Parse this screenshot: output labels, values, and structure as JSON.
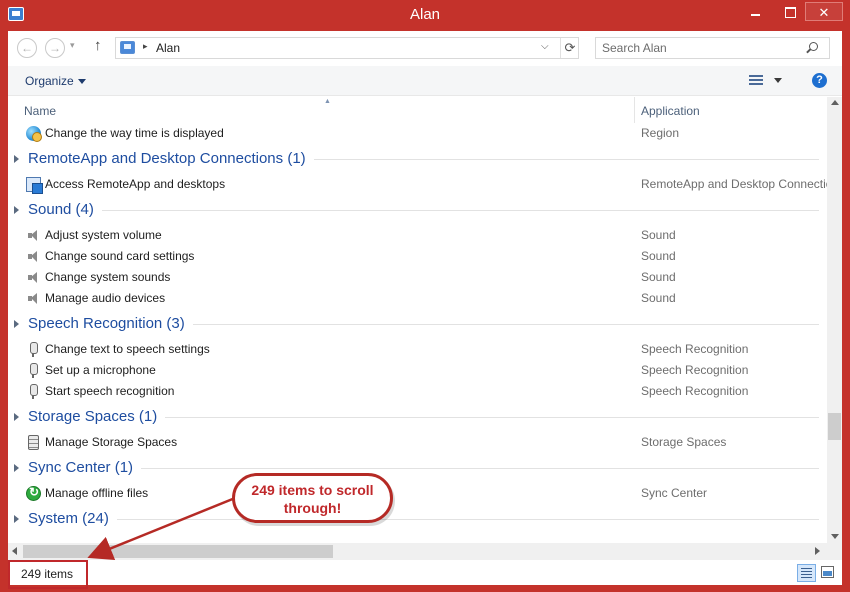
{
  "window": {
    "title": "Alan",
    "minimize_icon": "minimize-icon",
    "maximize_icon": "maximize-icon",
    "close_icon": "close-icon",
    "close_glyph": "✕"
  },
  "nav": {
    "back_glyph": "←",
    "forward_glyph": "→",
    "history_glyph": "▾",
    "up_glyph": "↑",
    "address_text": "Alan",
    "address_sep": "▸",
    "address_drop": "⌵",
    "refresh_glyph": "⟳",
    "search_placeholder": "Search Alan"
  },
  "command_bar": {
    "organize_label": "Organize"
  },
  "columns": {
    "name": "Name",
    "application": "Application",
    "sort_glyph": "▲"
  },
  "list": [
    {
      "kind": "item",
      "icon": "globe-clock-icon",
      "name": "Change the way time is displayed",
      "app": "Region"
    },
    {
      "kind": "group",
      "title": "RemoteApp and Desktop Connections (1)"
    },
    {
      "kind": "item",
      "icon": "remoteapp-icon",
      "name": "Access RemoteApp and desktops",
      "app": "RemoteApp and Desktop Connections"
    },
    {
      "kind": "group",
      "title": "Sound (4)"
    },
    {
      "kind": "item",
      "icon": "speaker-icon",
      "name": "Adjust system volume",
      "app": "Sound"
    },
    {
      "kind": "item",
      "icon": "speaker-icon",
      "name": "Change sound card settings",
      "app": "Sound"
    },
    {
      "kind": "item",
      "icon": "speaker-icon",
      "name": "Change system sounds",
      "app": "Sound"
    },
    {
      "kind": "item",
      "icon": "speaker-icon",
      "name": "Manage audio devices",
      "app": "Sound"
    },
    {
      "kind": "group",
      "title": "Speech Recognition (3)"
    },
    {
      "kind": "item",
      "icon": "microphone-icon",
      "name": "Change text to speech settings",
      "app": "Speech Recognition"
    },
    {
      "kind": "item",
      "icon": "microphone-icon",
      "name": "Set up a microphone",
      "app": "Speech Recognition"
    },
    {
      "kind": "item",
      "icon": "microphone-icon",
      "name": "Start speech recognition",
      "app": "Speech Recognition"
    },
    {
      "kind": "group",
      "title": "Storage Spaces (1)"
    },
    {
      "kind": "item",
      "icon": "storage-icon",
      "name": "Manage Storage Spaces",
      "app": "Storage Spaces"
    },
    {
      "kind": "group",
      "title": "Sync Center (1)"
    },
    {
      "kind": "item",
      "icon": "sync-icon",
      "name": "Manage offline files",
      "app": "Sync Center"
    },
    {
      "kind": "group",
      "title": "System (24)"
    }
  ],
  "status": {
    "item_count": "249 items"
  },
  "callout": {
    "line1": "249 items to scroll",
    "line2": "through!",
    "color": "#c0282b"
  },
  "colors": {
    "titlebar": "#c4322b",
    "group_title": "#1e4da0",
    "column_header": "#4c607a"
  }
}
